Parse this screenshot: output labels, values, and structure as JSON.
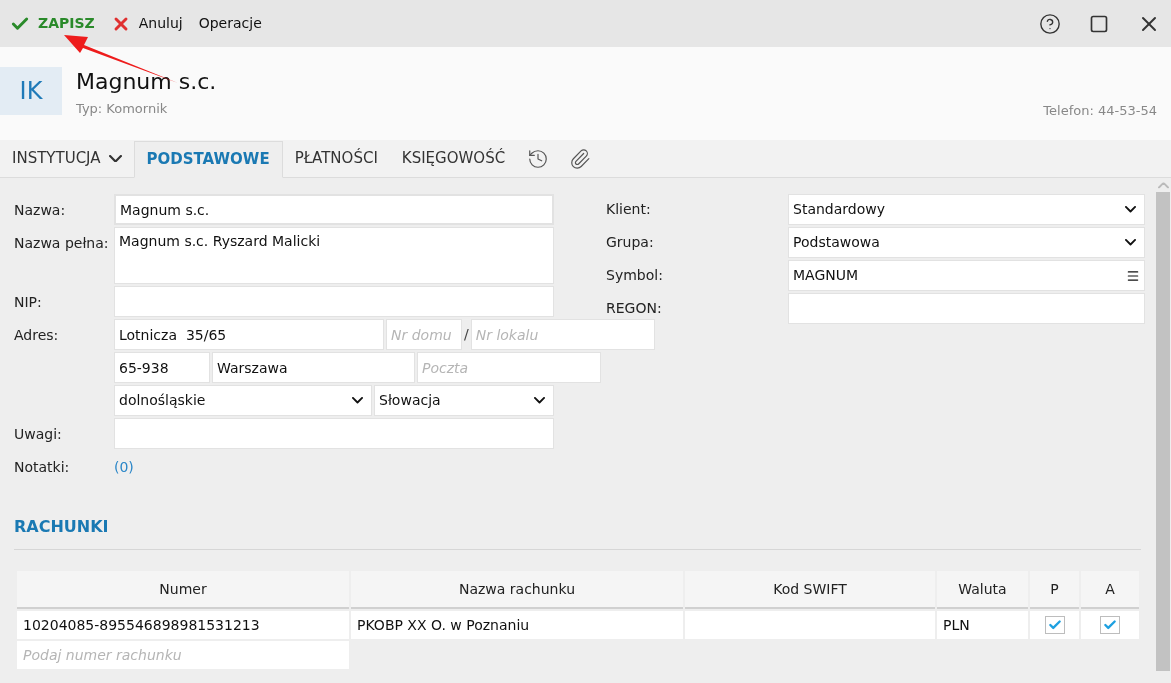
{
  "toolbar": {
    "save": "ZAPISZ",
    "cancel": "Anuluj",
    "operations": "Operacje"
  },
  "header": {
    "initials": "IK",
    "title": "Magnum s.c.",
    "subtitle": "Typ: Komornik",
    "phone": "Telefon: 44-53-54"
  },
  "tabs": [
    {
      "label": "INSTYTUCJA",
      "kind": "dropdown",
      "selected": false
    },
    {
      "label": "PODSTAWOWE",
      "kind": "text",
      "selected": true
    },
    {
      "label": "PŁATNOŚCI",
      "kind": "text",
      "selected": false
    },
    {
      "label": "KSIĘGOWOŚĆ",
      "kind": "text",
      "selected": false
    },
    {
      "kind": "history",
      "selected": false
    },
    {
      "kind": "attachment",
      "selected": false
    }
  ],
  "form_left": {
    "name_label": "Nazwa:",
    "name": "Magnum s.c.",
    "full_name_label": "Nazwa pełna:",
    "full_name": "Magnum s.c. Ryszard Malicki",
    "nip_label": "NIP:",
    "address_label": "Adres:",
    "street": "Lotnicza  35/65",
    "house_placeholder": "Nr domu",
    "separator": "/",
    "flat_placeholder": "Nr lokalu",
    "postcode": "65-938",
    "city": "Warszawa",
    "post_placeholder": "Poczta",
    "region": "dolnośląskie",
    "country": "Słowacja",
    "remarks_label": "Uwagi:",
    "notes_label": "Notatki:",
    "notes_count": "(0)"
  },
  "form_right": [
    {
      "label": "Klient:",
      "value": "Standardowy",
      "kind": "select"
    },
    {
      "label": "Grupa:",
      "value": "Podstawowa",
      "kind": "select"
    },
    {
      "label": "Symbol:",
      "value": "MAGNUM",
      "kind": "list"
    },
    {
      "label": "REGON:",
      "kind": "text"
    }
  ],
  "accounts": {
    "title": "RACHUNKI",
    "columns": [
      "Numer",
      "Nazwa rachunku",
      "Kod SWIFT",
      "Waluta",
      "P",
      "A"
    ],
    "rows": [
      {
        "number": "10204085-895546898981531213",
        "name": "PKOBP XX O. w Poznaniu",
        "currency": "PLN",
        "p": true,
        "a": true
      }
    ],
    "new_placeholder": "Podaj numer rachunku"
  }
}
